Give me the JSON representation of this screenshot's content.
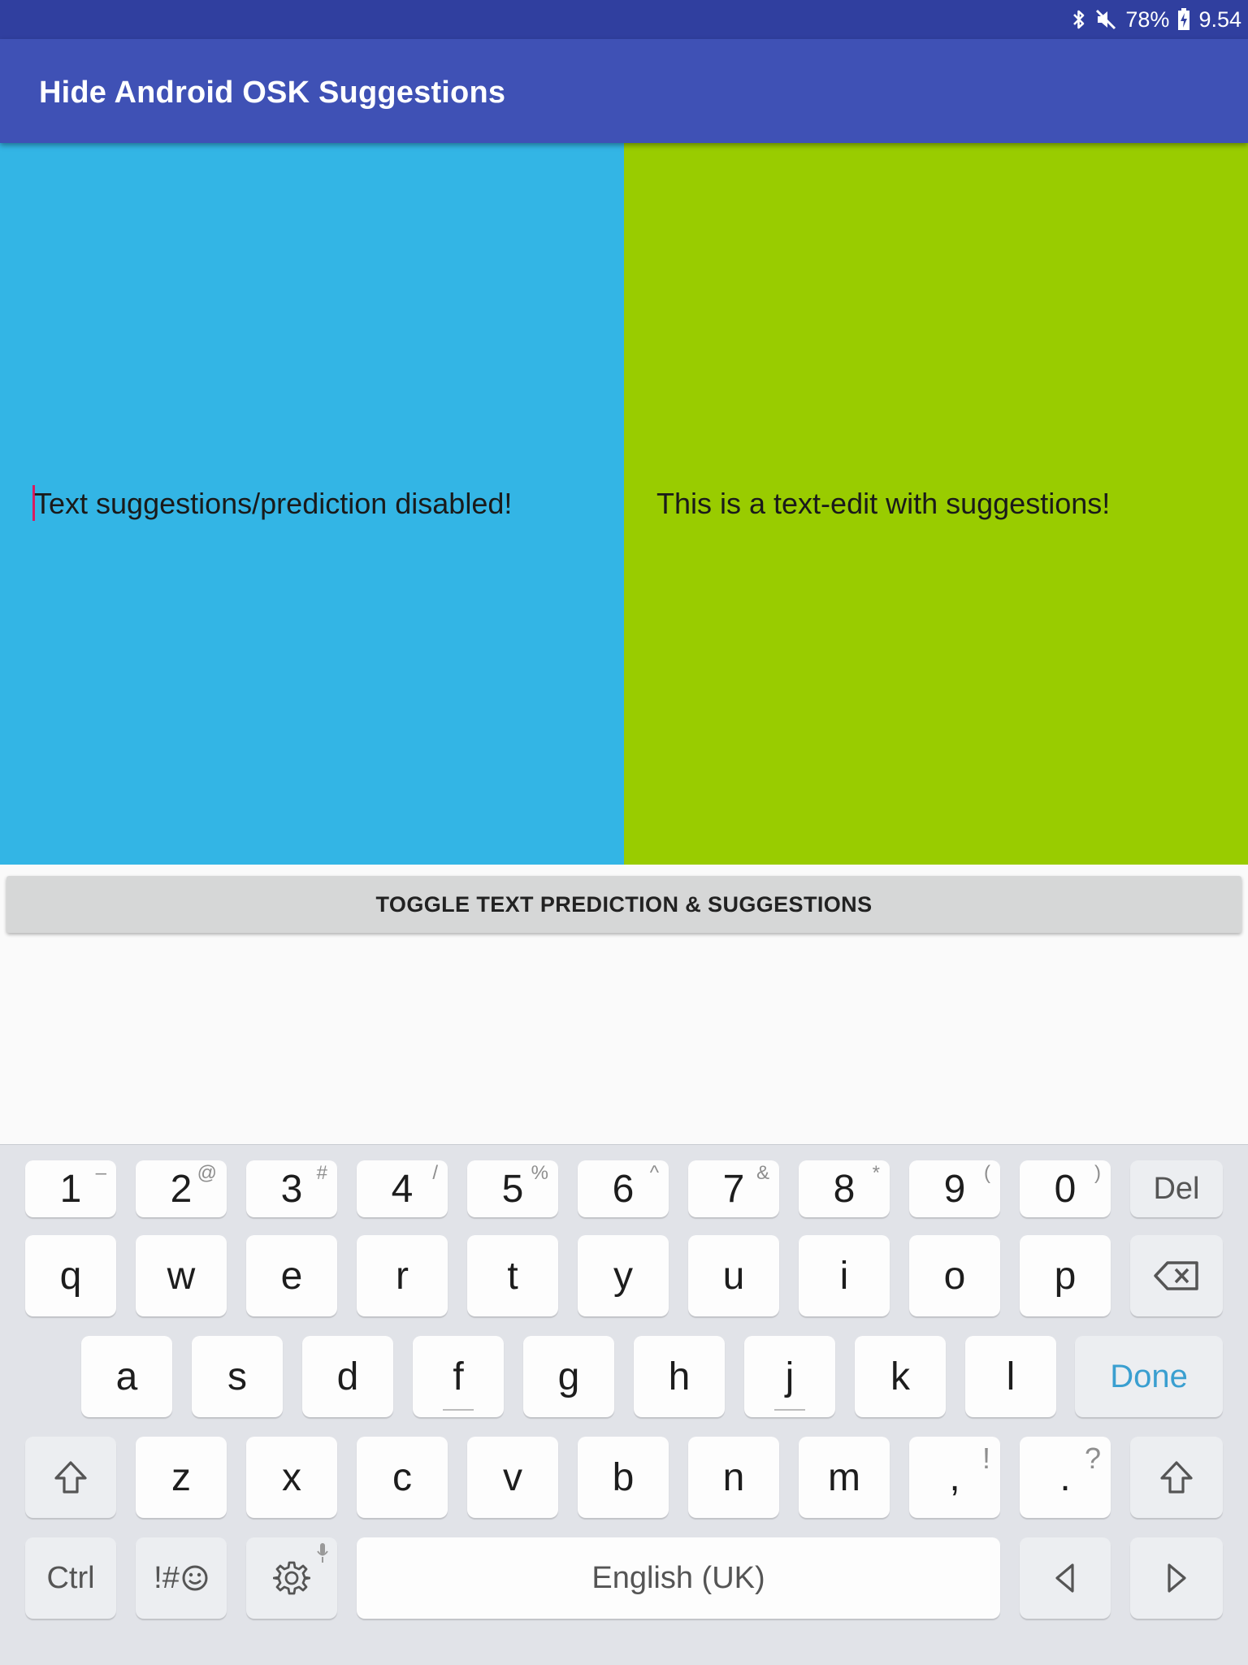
{
  "status_bar": {
    "battery": "78%",
    "time": "9.54",
    "icons": [
      "bluetooth-icon",
      "mute-icon",
      "battery-charging-icon"
    ]
  },
  "app_bar": {
    "title": "Hide Android OSK Suggestions"
  },
  "editors": {
    "left": {
      "text": "Text suggestions/prediction disabled!",
      "background": "#33b5e5"
    },
    "right": {
      "text": "This is a text-edit with suggestions!",
      "background": "#99cc00"
    }
  },
  "toggle_button": {
    "label": "TOGGLE TEXT PREDICTION & SUGGESTIONS"
  },
  "keyboard": {
    "number_row": [
      {
        "main": "1",
        "sup": "–"
      },
      {
        "main": "2",
        "sup": "@"
      },
      {
        "main": "3",
        "sup": "#"
      },
      {
        "main": "4",
        "sup": "/"
      },
      {
        "main": "5",
        "sup": "%"
      },
      {
        "main": "6",
        "sup": "^"
      },
      {
        "main": "7",
        "sup": "&"
      },
      {
        "main": "8",
        "sup": "*"
      },
      {
        "main": "9",
        "sup": "("
      },
      {
        "main": "0",
        "sup": ")"
      }
    ],
    "del_label": "Del",
    "row1": [
      "q",
      "w",
      "e",
      "r",
      "t",
      "y",
      "u",
      "i",
      "o",
      "p"
    ],
    "row2": [
      "a",
      "s",
      "d",
      "f",
      "g",
      "h",
      "j",
      "k",
      "l"
    ],
    "done_label": "Done",
    "row3": [
      "z",
      "x",
      "c",
      "v",
      "b",
      "n",
      "m"
    ],
    "comma": {
      "main": ",",
      "sup": "!"
    },
    "period": {
      "main": ".",
      "sup": "?"
    },
    "ctrl_label": "Ctrl",
    "symbols_label": "!#",
    "space_label": "English (UK)",
    "accent": "#3a9fd0"
  }
}
